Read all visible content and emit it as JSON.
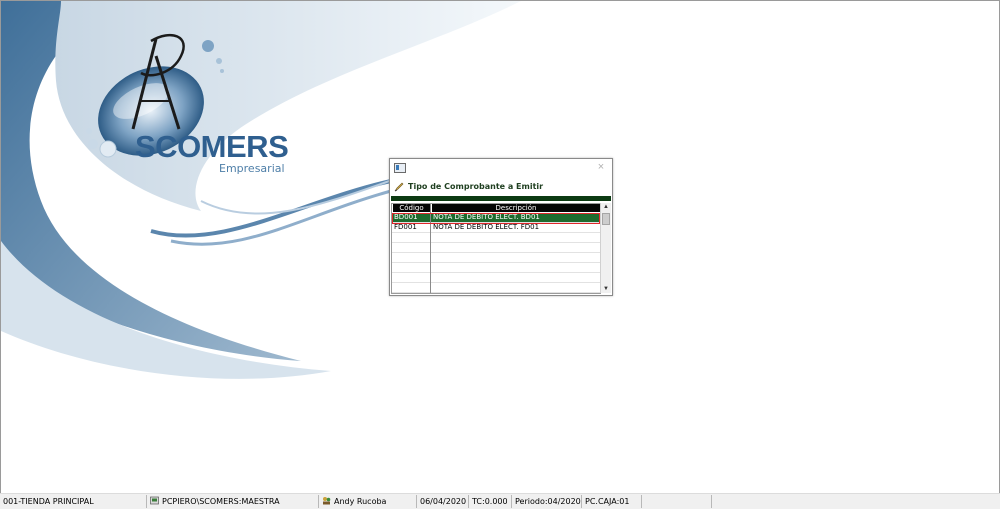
{
  "logo": {
    "brand": "SCOMERS",
    "subtitle": "Empresarial"
  },
  "dialog": {
    "title": "Tipo de Comprobante a Emitir",
    "close_glyph": "×",
    "columns": [
      "Código",
      "Descripción"
    ],
    "rows": [
      {
        "codigo": "BD001",
        "descripcion": "NOTA DE DEBITO ELECT. BD01",
        "selected": true
      },
      {
        "codigo": "FD001",
        "descripcion": "NOTA DE DEBITO ELECT. FD01",
        "selected": false
      }
    ],
    "scroll_up_glyph": "▲",
    "scroll_down_glyph": "▼"
  },
  "statusbar": {
    "store": "001-TIENDA PRINCIPAL",
    "database": "PCPIERO\\SCOMERS:MAESTRA",
    "user": "Andy Rucoba",
    "date": "06/04/2020",
    "tc": "TC:0.000",
    "period": "Periodo:04/2020",
    "pc": "PC.CAJA:01"
  },
  "colors": {
    "accent_green": "#1e6b2e",
    "dark_green_bar": "#0c3a12",
    "selection_outline": "#e0262a",
    "brand_blue": "#2f5f8f"
  },
  "icons": {
    "dialog_system": "window-icon",
    "dialog_title": "pencil-icon",
    "database": "database-icon",
    "user": "user-icon"
  }
}
